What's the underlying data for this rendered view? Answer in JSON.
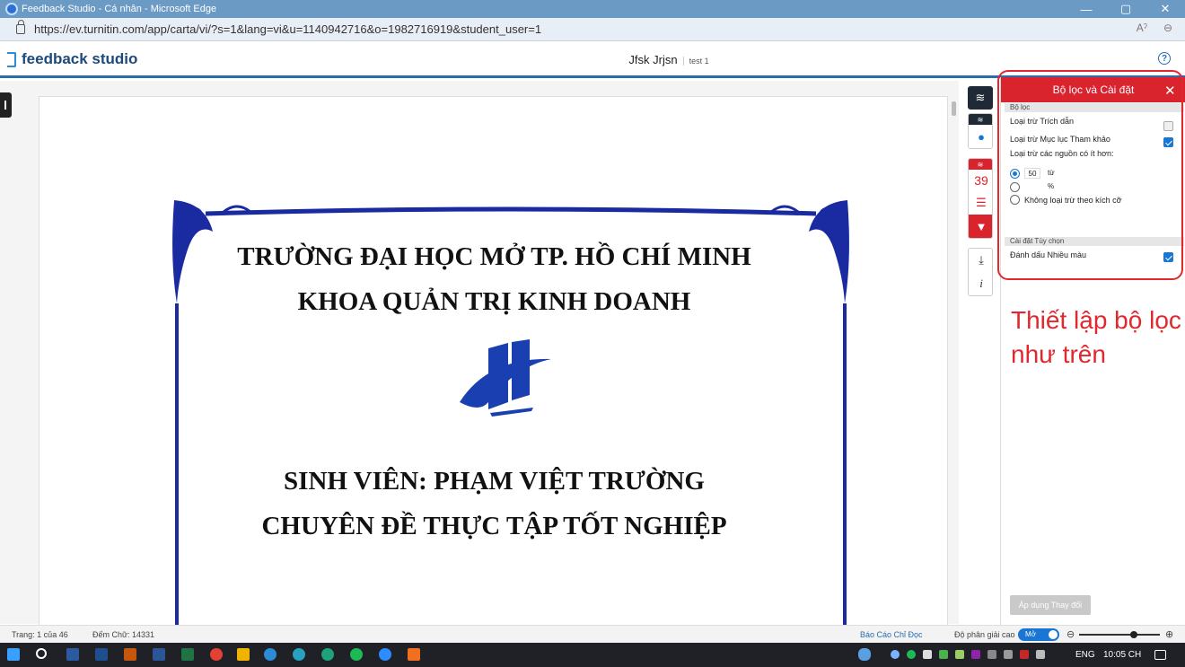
{
  "window": {
    "title": "Feedback Studio - Cá nhân - Microsoft Edge",
    "minimize": "—",
    "restore": "▢",
    "close": "✕"
  },
  "browser": {
    "url": "https://ev.turnitin.com/app/carta/vi/?s=1&lang=vi&u=1140942716&o=1982716919&student_user=1",
    "read_aloud": "Aˀ",
    "zoom": "⊖"
  },
  "app": {
    "brand": "feedback studio",
    "student_name": "Jfsk Jrjsn",
    "assignment": "test 1",
    "help": "?"
  },
  "document": {
    "line1": "TRƯỜNG ĐẠI HỌC MỞ TP. HỒ CHÍ MINH",
    "line2": "KHOA QUẢN TRỊ KINH DOANH",
    "line3": "SINH VIÊN: PHẠM VIỆT TRƯỜNG",
    "line4": "CHUYÊN ĐỀ THỰC TẬP TỐT NGHIỆP"
  },
  "toolbar": {
    "similarity_count": "39",
    "info": "i",
    "download": "⤓"
  },
  "panel": {
    "title": "Bộ lọc và Cài đặt",
    "close": "✕",
    "filters_section": "Bộ lọc",
    "exclude_quotes": "Loại trừ Trích dẫn",
    "exclude_quotes_checked": false,
    "exclude_bibliography": "Loại trừ Mục lục Tham khảo",
    "exclude_bibliography_checked": true,
    "exclude_small_sources": "Loại trừ các nguồn có ít hơn:",
    "words_value": "50",
    "words_unit": "từ",
    "percent_value": "",
    "percent_unit": "%",
    "no_size_exclusion": "Không loại trừ theo kích cỡ",
    "options_section": "Cài đặt Tùy chọn",
    "multi_color": "Đánh dấu Nhiều màu",
    "multi_color_checked": true,
    "apply_button": "Áp dụng Thay đổi"
  },
  "annotation": {
    "note": "Thiết lập bộ lọc như trên",
    "color": "#e0282e"
  },
  "status": {
    "page": "Trang: 1 của 46",
    "word_count": "Đếm Chữ: 14331",
    "text_only_report": "Báo Cáo Chỉ Đọc",
    "high_resolution": "Độ phân giải cao",
    "toggle_label": "Mở",
    "zoom_out": "⊖",
    "zoom_in": "⊕",
    "zoom_level_fraction": 0.7
  },
  "taskbar": {
    "language": "ENG",
    "time": "10:05 CH"
  },
  "colors": {
    "accent": "#d9232d",
    "brand_blue": "#2b6cb0",
    "checkbox_blue": "#1976d2"
  }
}
